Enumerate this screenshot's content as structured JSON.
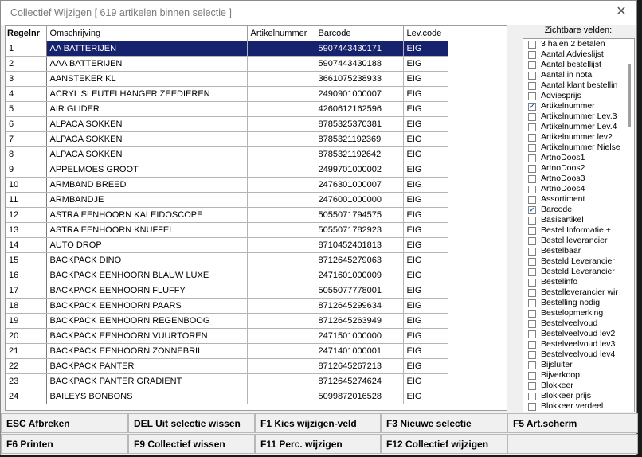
{
  "window": {
    "title": "Collectief Wijzigen [ 619 artikelen binnen selectie ]"
  },
  "grid": {
    "columns": [
      "Regelnr",
      "Omschrijving",
      "Artikelnummer",
      "Barcode",
      "Lev.code"
    ],
    "rows": [
      {
        "nr": "1",
        "omschrijving": "AA BATTERIJEN",
        "artikelnummer": "",
        "barcode": "5907443430171",
        "levcode": "EIG"
      },
      {
        "nr": "2",
        "omschrijving": "AAA BATTERIJEN",
        "artikelnummer": "",
        "barcode": "5907443430188",
        "levcode": "EIG"
      },
      {
        "nr": "3",
        "omschrijving": "AANSTEKER KL",
        "artikelnummer": "",
        "barcode": "3661075238933",
        "levcode": "EIG"
      },
      {
        "nr": "4",
        "omschrijving": "ACRYL SLEUTELHANGER ZEEDIEREN",
        "artikelnummer": "",
        "barcode": "2490901000007",
        "levcode": "EIG"
      },
      {
        "nr": "5",
        "omschrijving": "AIR GLIDER",
        "artikelnummer": "",
        "barcode": "4260612162596",
        "levcode": "EIG"
      },
      {
        "nr": "6",
        "omschrijving": "ALPACA SOKKEN",
        "artikelnummer": "",
        "barcode": "8785325370381",
        "levcode": "EIG"
      },
      {
        "nr": "7",
        "omschrijving": "ALPACA SOKKEN",
        "artikelnummer": "",
        "barcode": "8785321192369",
        "levcode": "EIG"
      },
      {
        "nr": "8",
        "omschrijving": "ALPACA SOKKEN",
        "artikelnummer": "",
        "barcode": "8785321192642",
        "levcode": "EIG"
      },
      {
        "nr": "9",
        "omschrijving": "APPELMOES GROOT",
        "artikelnummer": "",
        "barcode": "2499701000002",
        "levcode": "EIG"
      },
      {
        "nr": "10",
        "omschrijving": "ARMBAND BREED",
        "artikelnummer": "",
        "barcode": "2476301000007",
        "levcode": "EIG"
      },
      {
        "nr": "11",
        "omschrijving": "ARMBANDJE",
        "artikelnummer": "",
        "barcode": "2476001000000",
        "levcode": "EIG"
      },
      {
        "nr": "12",
        "omschrijving": "ASTRA EENHOORN KALEIDOSCOPE",
        "artikelnummer": "",
        "barcode": "5055071794575",
        "levcode": "EIG"
      },
      {
        "nr": "13",
        "omschrijving": "ASTRA EENHOORN KNUFFEL",
        "artikelnummer": "",
        "barcode": "5055071782923",
        "levcode": "EIG"
      },
      {
        "nr": "14",
        "omschrijving": "AUTO DROP",
        "artikelnummer": "",
        "barcode": "8710452401813",
        "levcode": "EIG"
      },
      {
        "nr": "15",
        "omschrijving": "BACKPACK DINO",
        "artikelnummer": "",
        "barcode": "8712645279063",
        "levcode": "EIG"
      },
      {
        "nr": "16",
        "omschrijving": "BACKPACK EENHOORN BLAUW LUXE",
        "artikelnummer": "",
        "barcode": "2471601000009",
        "levcode": "EIG"
      },
      {
        "nr": "17",
        "omschrijving": "BACKPACK EENHOORN FLUFFY",
        "artikelnummer": "",
        "barcode": "5055077778001",
        "levcode": "EIG"
      },
      {
        "nr": "18",
        "omschrijving": "BACKPACK EENHOORN PAARS",
        "artikelnummer": "",
        "barcode": "8712645299634",
        "levcode": "EIG"
      },
      {
        "nr": "19",
        "omschrijving": "BACKPACK EENHOORN REGENBOOG",
        "artikelnummer": "",
        "barcode": "8712645263949",
        "levcode": "EIG"
      },
      {
        "nr": "20",
        "omschrijving": "BACKPACK EENHOORN VUURTOREN",
        "artikelnummer": "",
        "barcode": "2471501000000",
        "levcode": "EIG"
      },
      {
        "nr": "21",
        "omschrijving": "BACKPACK EENHOORN ZONNEBRIL",
        "artikelnummer": "",
        "barcode": "2471401000001",
        "levcode": "EIG"
      },
      {
        "nr": "22",
        "omschrijving": "BACKPACK PANTER",
        "artikelnummer": "",
        "barcode": "8712645267213",
        "levcode": "EIG"
      },
      {
        "nr": "23",
        "omschrijving": "BACKPACK PANTER GRADIENT",
        "artikelnummer": "",
        "barcode": "8712645274624",
        "levcode": "EIG"
      },
      {
        "nr": "24",
        "omschrijving": "BAILEYS BONBONS",
        "artikelnummer": "",
        "barcode": "5099872016528",
        "levcode": "EIG"
      }
    ]
  },
  "fields_panel": {
    "title": "Zichtbare velden:",
    "items": [
      {
        "label": "3 halen 2 betalen",
        "checked": false
      },
      {
        "label": "Aantal Advieslijst",
        "checked": false
      },
      {
        "label": "Aantal bestellijst",
        "checked": false
      },
      {
        "label": "Aantal in nota",
        "checked": false
      },
      {
        "label": "Aantal klant bestellin",
        "checked": false
      },
      {
        "label": "Adviesprijs",
        "checked": false
      },
      {
        "label": "Artikelnummer",
        "checked": true
      },
      {
        "label": "Artikelnummer Lev.3",
        "checked": false
      },
      {
        "label": "Artikelnummer Lev.4",
        "checked": false
      },
      {
        "label": "Artikelnummer lev2",
        "checked": false
      },
      {
        "label": "Artikelnummer Nielse",
        "checked": false
      },
      {
        "label": "ArtnoDoos1",
        "checked": false
      },
      {
        "label": "ArtnoDoos2",
        "checked": false
      },
      {
        "label": "ArtnoDoos3",
        "checked": false
      },
      {
        "label": "ArtnoDoos4",
        "checked": false
      },
      {
        "label": "Assortiment",
        "checked": false
      },
      {
        "label": "Barcode",
        "checked": true
      },
      {
        "label": "Basisartikel",
        "checked": false
      },
      {
        "label": "Bestel Informatie +",
        "checked": false
      },
      {
        "label": "Bestel leverancier",
        "checked": false
      },
      {
        "label": "Bestelbaar",
        "checked": false
      },
      {
        "label": "Besteld Leverancier",
        "checked": false
      },
      {
        "label": "Besteld Leverancier",
        "checked": false
      },
      {
        "label": "Bestelinfo",
        "checked": false
      },
      {
        "label": "Bestelleverancier wir",
        "checked": false
      },
      {
        "label": "Bestelling nodig",
        "checked": false
      },
      {
        "label": "Bestelopmerking",
        "checked": false
      },
      {
        "label": "Bestelveelvoud",
        "checked": false
      },
      {
        "label": "Bestelveelvoud lev2",
        "checked": false
      },
      {
        "label": "Bestelveelvoud lev3",
        "checked": false
      },
      {
        "label": "Bestelveelvoud lev4",
        "checked": false
      },
      {
        "label": "Bijsluiter",
        "checked": false
      },
      {
        "label": "Bijverkoop",
        "checked": false
      },
      {
        "label": "Blokkeer",
        "checked": false
      },
      {
        "label": "Blokkeer prijs",
        "checked": false
      },
      {
        "label": "Blokkeer verdeel",
        "checked": false
      }
    ]
  },
  "function_keys": [
    {
      "key": "ESC",
      "label": "ESC Afbreken"
    },
    {
      "key": "DEL",
      "label": "DEL Uit selectie wissen"
    },
    {
      "key": "F1",
      "label": "F1 Kies wijzigen-veld"
    },
    {
      "key": "F3",
      "label": "F3 Nieuwe selectie"
    },
    {
      "key": "F5",
      "label": "F5 Art.scherm"
    },
    {
      "key": "F6",
      "label": "F6 Printen"
    },
    {
      "key": "F9",
      "label": "F9 Collectief wissen"
    },
    {
      "key": "F11",
      "label": "F11 Perc. wijzigen"
    },
    {
      "key": "F12",
      "label": "F12 Collectief wijzigen"
    }
  ],
  "colors": {
    "selection": "#16226e",
    "checkmark": "#1a56c7",
    "window_bg": "#f0f0f0"
  }
}
